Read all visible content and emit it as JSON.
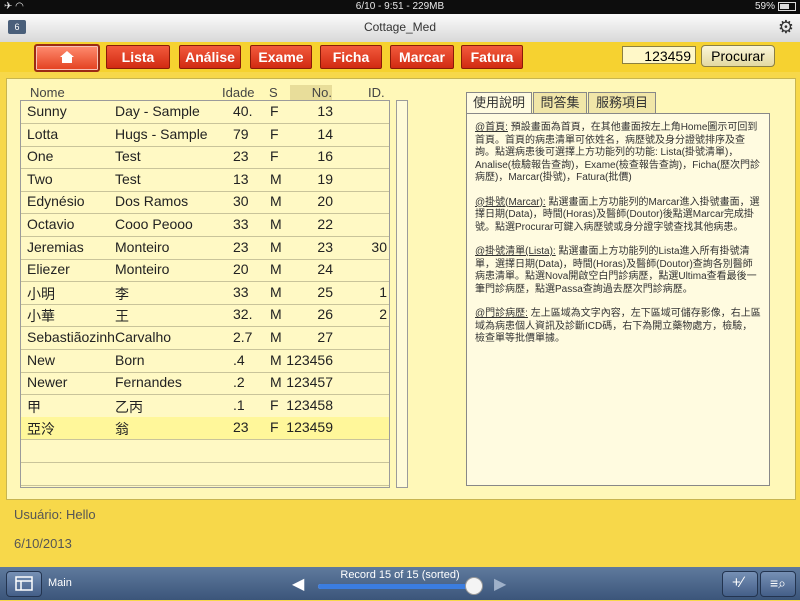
{
  "status": {
    "time_battery": "6/10 - 9:51 - 229MB",
    "battery": "59%"
  },
  "window": {
    "badge": "6",
    "title": "Cottage_Med"
  },
  "nav": {
    "lista": "Lista",
    "analise": "Análise",
    "exame": "Exame",
    "ficha": "Ficha",
    "marcar": "Marcar",
    "fatura": "Fatura",
    "search_value": "123459",
    "procurar": "Procurar"
  },
  "table": {
    "headers": {
      "nome": "Nome",
      "idade": "Idade",
      "s": "S",
      "no": "No.",
      "id": "ID."
    },
    "rows": [
      {
        "first": "Sunny",
        "last": "Day - Sample",
        "idade": "40.",
        "s": "F",
        "no": "13",
        "id": ""
      },
      {
        "first": "Lotta",
        "last": "Hugs - Sample",
        "idade": "79",
        "s": "F",
        "no": "14",
        "id": ""
      },
      {
        "first": "One",
        "last": "Test",
        "idade": "23",
        "s": "F",
        "no": "16",
        "id": ""
      },
      {
        "first": "Two",
        "last": "Test",
        "idade": "13",
        "s": "M",
        "no": "19",
        "id": ""
      },
      {
        "first": "Edynésio",
        "last": "Dos Ramos",
        "idade": "30",
        "s": "M",
        "no": "20",
        "id": ""
      },
      {
        "first": "Octavio",
        "last": "Cooo Peooo",
        "idade": "33",
        "s": "M",
        "no": "22",
        "id": ""
      },
      {
        "first": "Jeremias",
        "last": "Monteiro",
        "idade": "23",
        "s": "M",
        "no": "23",
        "id": "30"
      },
      {
        "first": "Eliezer",
        "last": "Monteiro",
        "idade": "20",
        "s": "M",
        "no": "24",
        "id": ""
      },
      {
        "first": "小明",
        "last": "李",
        "idade": "33",
        "s": "M",
        "no": "25",
        "id": "1"
      },
      {
        "first": "小華",
        "last": "王",
        "idade": "32.",
        "s": "M",
        "no": "26",
        "id": "2"
      },
      {
        "first": "Sebastiãozinh",
        "last": "Carvalho",
        "idade": "2.7",
        "s": "M",
        "no": "27",
        "id": ""
      },
      {
        "first": "New",
        "last": "Born",
        "idade": ".4",
        "s": "M",
        "no": "123456",
        "id": ""
      },
      {
        "first": "Newer",
        "last": "Fernandes",
        "idade": ".2",
        "s": "M",
        "no": "123457",
        "id": ""
      },
      {
        "first": "甲",
        "last": "乙丙",
        "idade": ".1",
        "s": "F",
        "no": "123458",
        "id": ""
      },
      {
        "first": "亞泠",
        "last": "翁",
        "idade": "23",
        "s": "F",
        "no": "123459",
        "id": ""
      }
    ]
  },
  "tabs": {
    "t1": "使用說明",
    "t2": "問答集",
    "t3": "服務項目"
  },
  "help": {
    "p1_title": "@首頁:",
    "p1_body": " 預設畫面為首頁，在其他畫面按左上角Home圖示可回到首頁。首頁的病患清單可依姓名，病歷號及身分證號排序及查詢。點選病患後可選擇上方功能列的功能: Lista(掛號清單)，Analise(檢驗報告查詢)，Exame(檢查報告查詢)，Ficha(歷次門診病歷)，Marcar(掛號)，Fatura(批價)",
    "p2_title": "@掛號(Marcar):",
    "p2_body": " 點選畫面上方功能列的Marcar進入掛號畫面，選擇日期(Data)，時間(Horas)及醫師(Doutor)後點選Marcar完成掛號。點選Procurar可鍵入病歷號或身分證字號查找其他病患。",
    "p3_title": "@掛號清單(Lista):",
    "p3_body": " 點選畫面上方功能列的Lista進入所有掛號清單，選擇日期(Data)，時間(Horas)及醫師(Doutor)查詢各別醫師病患清單。點選Nova開啟空白門診病歷，點選Ultima查看最後一筆門診病歷，點選Passa查詢過去歷次門診病歷。",
    "p4_title": "@門診病歷:",
    "p4_body": " 左上區域為文字內容，左下區域可儲存影像，右上區域為病患個人資訊及診斷ICD碼，右下為開立藥物處方，檢驗，檢查單等批價單據。"
  },
  "footer": {
    "user": "Usuário: Hello",
    "date": "6/10/2013"
  },
  "bottom": {
    "layout": "Main",
    "record": "Record 15 of 15 (sorted)",
    "progress": 0.97
  }
}
